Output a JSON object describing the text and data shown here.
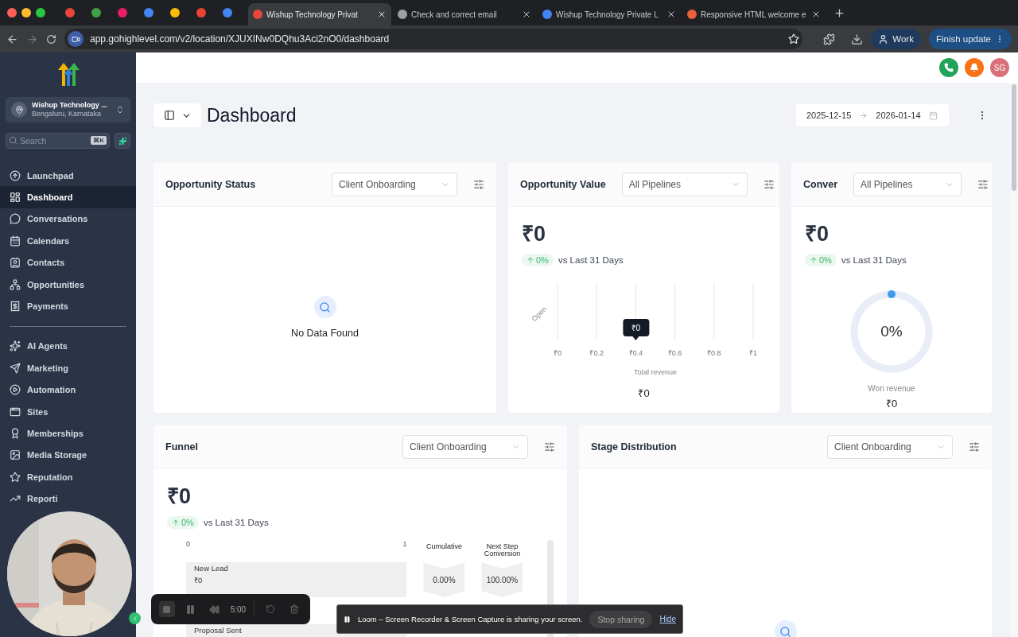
{
  "browser": {
    "tabs": [
      {
        "title": "Wishup Technology Privat",
        "selected": true
      },
      {
        "title": "Check and correct email",
        "selected": false
      },
      {
        "title": "Wishup Technology Private L",
        "selected": false
      },
      {
        "title": "Responsive HTML welcome e",
        "selected": false
      }
    ],
    "address": "app.gohighlevel.com/v2/location/XJUXINw0DQhu3Aci2nO0/dashboard",
    "profile": "Work",
    "update_button": "Finish update"
  },
  "sidebar": {
    "account": {
      "name": "Wishup Technology ...",
      "location": "Bengaluru, Karnataka"
    },
    "search": {
      "placeholder": "Search",
      "shortcut": "⌘K"
    },
    "groups": [
      {
        "items": [
          {
            "label": "Launchpad",
            "selected": false
          },
          {
            "label": "Dashboard",
            "selected": true
          },
          {
            "label": "Conversations",
            "selected": false
          },
          {
            "label": "Calendars",
            "selected": false
          },
          {
            "label": "Contacts",
            "selected": false
          },
          {
            "label": "Opportunities",
            "selected": false
          },
          {
            "label": "Payments",
            "selected": false
          }
        ]
      },
      {
        "items": [
          {
            "label": "AI Agents",
            "selected": false
          },
          {
            "label": "Marketing",
            "selected": false
          },
          {
            "label": "Automation",
            "selected": false
          },
          {
            "label": "Sites",
            "selected": false
          },
          {
            "label": "Memberships",
            "selected": false
          },
          {
            "label": "Media Storage",
            "selected": false
          },
          {
            "label": "Reputation",
            "selected": false
          },
          {
            "label": "Reporti",
            "selected": false
          }
        ]
      }
    ]
  },
  "topbar": {
    "avatar": "SG"
  },
  "header": {
    "title": "Dashboard",
    "date_start": "2025-12-15",
    "date_end": "2026-01-14"
  },
  "widgets": [
    {
      "kind": "status",
      "title": "Opportunity Status",
      "select": "Client Onboarding",
      "empty_text": "No Data Found"
    },
    {
      "kind": "value",
      "title": "Opportunity Value",
      "select": "All Pipelines",
      "amount": "₹0",
      "change": "0%",
      "compare": "vs Last 31 Days",
      "tooltip": "₹0",
      "total": "₹0",
      "chart_data": {
        "type": "bar",
        "orientation": "horizontal",
        "grid": true,
        "categories": [
          "Open"
        ],
        "values": [
          0
        ],
        "xlabel": "Total revenue",
        "xlim": [
          0,
          1
        ],
        "xticks": [
          {
            "value": 0,
            "label": "₹0"
          },
          {
            "value": 0.2,
            "label": "₹0.2"
          },
          {
            "value": 0.4,
            "label": "₹0.4"
          },
          {
            "value": 0.6,
            "label": "₹0.6"
          },
          {
            "value": 0.8,
            "label": "₹0.8"
          },
          {
            "value": 1,
            "label": "₹1"
          }
        ]
      }
    },
    {
      "kind": "conversion",
      "title": "Conver",
      "select": "All Pipelines",
      "amount": "₹0",
      "change": "0%",
      "compare": "vs Last 31 Days",
      "gauge": {
        "label": "0%"
      },
      "won_label": "Won revenue",
      "won": "₹0"
    },
    {
      "kind": "funnel",
      "title": "Funnel",
      "select": "Client Onboarding",
      "amount": "₹0",
      "change": "0%",
      "compare": "vs Last 31 Days",
      "axis": [
        "0",
        "1"
      ],
      "columns": [
        "Cumulative",
        "Next Step Conversion"
      ],
      "rows": [
        {
          "name": "New Lead",
          "value": "₹0",
          "cumulative": "0.00%",
          "next": "100.00%"
        },
        {
          "name": "Proposal Sent"
        }
      ]
    },
    {
      "kind": "stage",
      "title": "Stage Distribution",
      "select": "Client Onboarding"
    }
  ],
  "recorder": {
    "timer": "5:00"
  },
  "share_bar": {
    "message": "Loom – Screen Recorder & Screen Capture is sharing your screen.",
    "stop": "Stop sharing",
    "hide": "Hide"
  }
}
